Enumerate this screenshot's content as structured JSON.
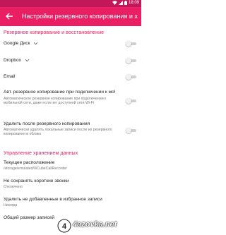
{
  "status_bar": {
    "time": "18:09"
  },
  "app_bar": {
    "title": "Настройки резервного копирования и х"
  },
  "sections": {
    "backup": {
      "title": "Резервное копирование и восстановление"
    },
    "storage": {
      "title": "Управление хранением данных"
    }
  },
  "rows": {
    "google_drive": {
      "title": "Google Диск",
      "toggle_on": false
    },
    "dropbox": {
      "title": "Dropbox",
      "toggle_on": false
    },
    "email": {
      "title": "Email",
      "toggle_on": false
    },
    "auto_backup": {
      "title": "Авт. резервное копирование при подключении к мо!",
      "subtitle": "Автоматическое резервное копирование при подключении к мобильной сети, даже если нет доступной сети Wi-Fi",
      "toggle_on": false
    },
    "delete_after": {
      "title": "Удалить после резервного копирования",
      "subtitle": "Автоматически удалять локальные записи после их резервного копирования в облако",
      "toggle_on": false
    },
    "location": {
      "title": "Текущее расположение",
      "subtitle": "/storage/emulated/0/CubeCallRecorder"
    },
    "short_calls": {
      "title": "Не сохранять короткие звонки",
      "subtitle": "Отключено"
    },
    "delete_unfav": {
      "title": "Удалить не добавленные в избранное записи",
      "subtitle": "Никогда"
    },
    "total_size": {
      "title": "Общий размер записей"
    }
  },
  "icons": {
    "back": "arrow-back-icon",
    "chevron": "chevron-down-icon",
    "wifi": "wifi-icon",
    "signal": "signal-icon",
    "battery": "battery-icon"
  },
  "colors": {
    "accent": "#e91e63",
    "status_bar": "#c2185b"
  },
  "watermark": {
    "text": "4azovka.net"
  }
}
